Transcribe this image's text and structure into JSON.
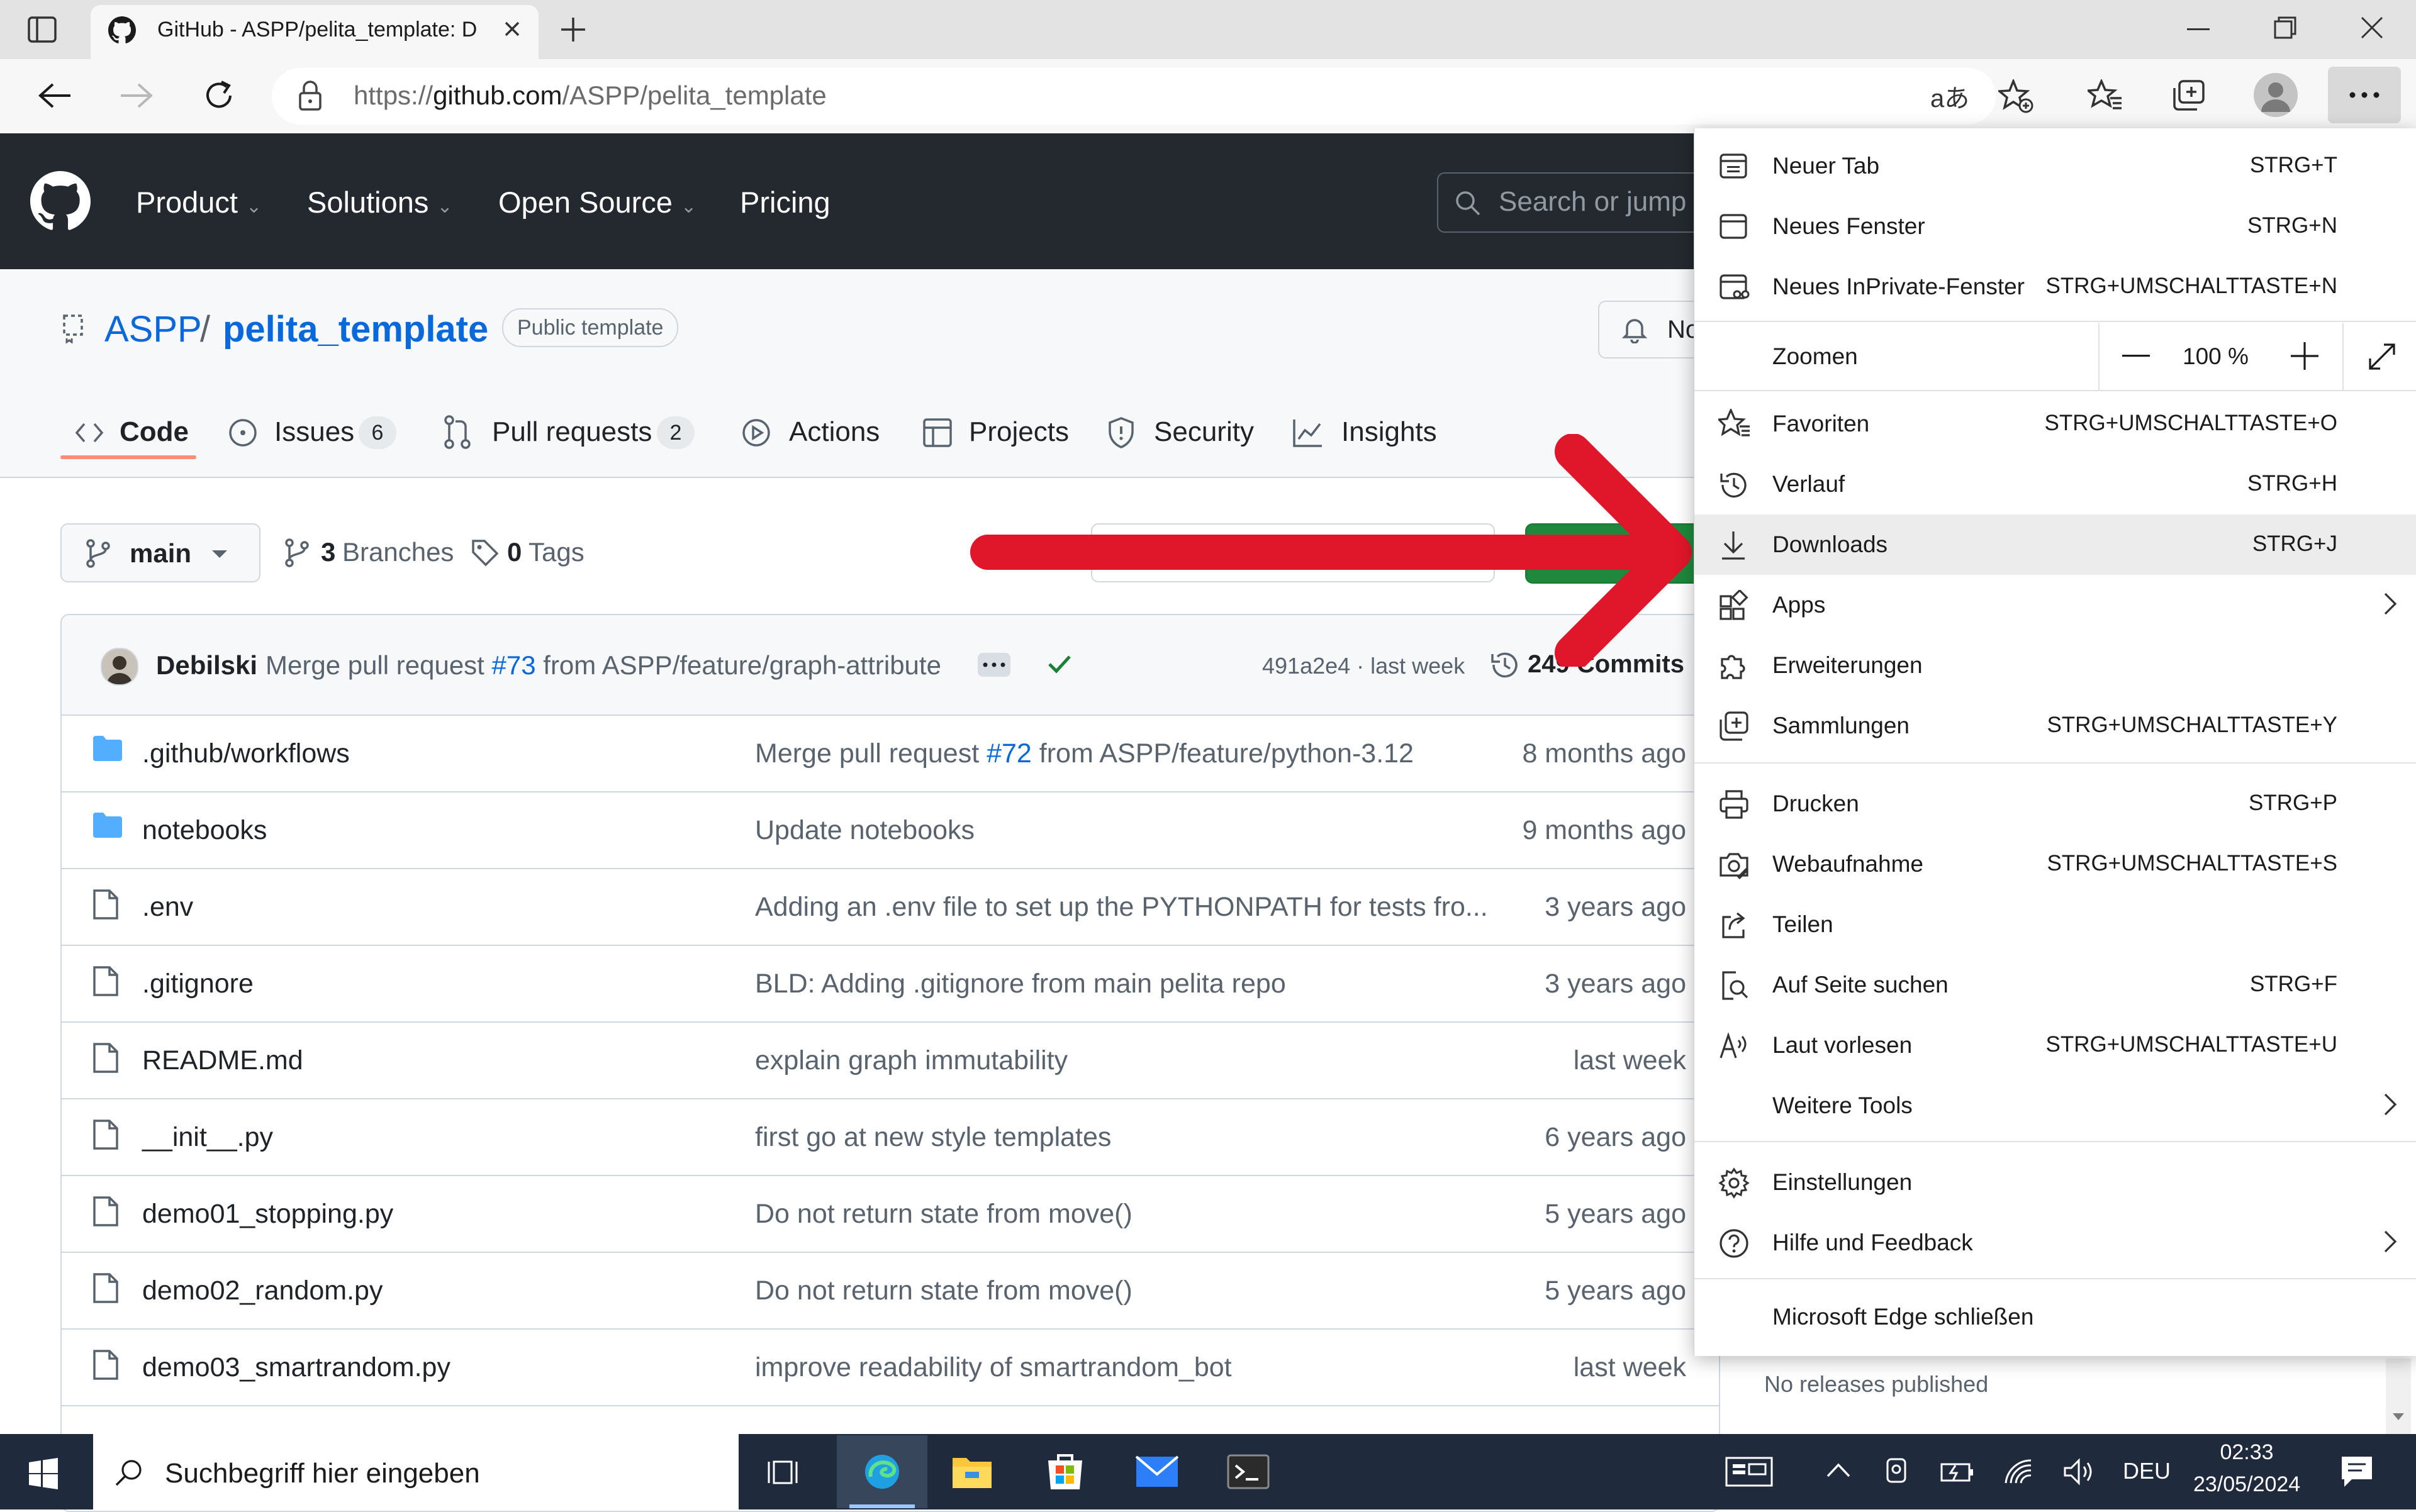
{
  "browser": {
    "tab_title": "GitHub - ASPP/pelita_template: D",
    "url_prefix": "https://",
    "url_domain": "github.com",
    "url_path": "/ASPP/pelita_template"
  },
  "github_header": {
    "nav": [
      "Product",
      "Solutions",
      "Open Source",
      "Pricing"
    ],
    "search_placeholder": "Search or jump t"
  },
  "repo": {
    "owner": "ASPP",
    "separator": "/",
    "name": "pelita_template",
    "badge": "Public template",
    "notify_label": "No",
    "tabs": [
      {
        "label": "Code",
        "count": ""
      },
      {
        "label": "Issues",
        "count": "6"
      },
      {
        "label": "Pull requests",
        "count": "2"
      },
      {
        "label": "Actions",
        "count": ""
      },
      {
        "label": "Projects",
        "count": ""
      },
      {
        "label": "Security",
        "count": ""
      },
      {
        "label": "Insights",
        "count": ""
      }
    ],
    "branch": "main",
    "branches_count": "3",
    "branches_label": "Branches",
    "tags_count": "0",
    "tags_label": "Tags"
  },
  "last_commit": {
    "author": "Debilski",
    "msg_prefix": "Merge pull request",
    "pr": "#73",
    "msg_suffix": "from ASPP/feature/graph-attribute",
    "sha_time": "491a2e4 · last week",
    "commits": "249 Commits"
  },
  "files": [
    {
      "name": ".github/workflows",
      "type": "folder",
      "msg_prefix": "Merge pull request ",
      "msg_link": "#72",
      "msg_suffix": " from ASPP/feature/python-3.12",
      "time": "8 months ago"
    },
    {
      "name": "notebooks",
      "type": "folder",
      "msg_prefix": "Update notebooks",
      "msg_link": "",
      "msg_suffix": "",
      "time": "9 months ago"
    },
    {
      "name": ".env",
      "type": "file",
      "msg_prefix": "Adding an .env file to set up the PYTHONPATH for tests fro...",
      "msg_link": "",
      "msg_suffix": "",
      "time": "3 years ago"
    },
    {
      "name": ".gitignore",
      "type": "file",
      "msg_prefix": "BLD: Adding .gitignore from main pelita repo",
      "msg_link": "",
      "msg_suffix": "",
      "time": "3 years ago"
    },
    {
      "name": "README.md",
      "type": "file",
      "msg_prefix": "explain graph immutability",
      "msg_link": "",
      "msg_suffix": "",
      "time": "last week"
    },
    {
      "name": "__init__.py",
      "type": "file",
      "msg_prefix": "first go at new style templates",
      "msg_link": "",
      "msg_suffix": "",
      "time": "6 years ago"
    },
    {
      "name": "demo01_stopping.py",
      "type": "file",
      "msg_prefix": "Do not return state from move()",
      "msg_link": "",
      "msg_suffix": "",
      "time": "5 years ago"
    },
    {
      "name": "demo02_random.py",
      "type": "file",
      "msg_prefix": "Do not return state from move()",
      "msg_link": "",
      "msg_suffix": "",
      "time": "5 years ago"
    },
    {
      "name": "demo03_smartrandom.py",
      "type": "file",
      "msg_prefix": "improve readability of smartrandom_bot",
      "msg_link": "",
      "msg_suffix": "",
      "time": "last week"
    }
  ],
  "sidebar": {
    "releases_text": "No releases published"
  },
  "edge_menu": {
    "new_tab": {
      "label": "Neuer Tab",
      "shortcut": "STRG+T"
    },
    "new_window": {
      "label": "Neues Fenster",
      "shortcut": "STRG+N"
    },
    "inprivate": {
      "label": "Neues InPrivate-Fenster",
      "shortcut": "STRG+UMSCHALTTASTE+N"
    },
    "zoom": {
      "label": "Zoomen",
      "value": "100 %"
    },
    "favorites": {
      "label": "Favoriten",
      "shortcut": "STRG+UMSCHALTTASTE+O"
    },
    "history": {
      "label": "Verlauf",
      "shortcut": "STRG+H"
    },
    "downloads": {
      "label": "Downloads",
      "shortcut": "STRG+J"
    },
    "apps": {
      "label": "Apps"
    },
    "extensions": {
      "label": "Erweiterungen"
    },
    "collections": {
      "label": "Sammlungen",
      "shortcut": "STRG+UMSCHALTTASTE+Y"
    },
    "print": {
      "label": "Drucken",
      "shortcut": "STRG+P"
    },
    "screenshot": {
      "label": "Webaufnahme",
      "shortcut": "STRG+UMSCHALTTASTE+S"
    },
    "share": {
      "label": "Teilen"
    },
    "find": {
      "label": "Auf Seite suchen",
      "shortcut": "STRG+F"
    },
    "read_aloud": {
      "label": "Laut vorlesen",
      "shortcut": "STRG+UMSCHALTTASTE+U"
    },
    "more_tools": {
      "label": "Weitere Tools"
    },
    "settings": {
      "label": "Einstellungen"
    },
    "help": {
      "label": "Hilfe und Feedback"
    },
    "close_edge": {
      "label": "Microsoft Edge schließen"
    }
  },
  "taskbar": {
    "search_placeholder": "Suchbegriff hier eingeben",
    "language": "DEU",
    "time": "02:33",
    "date": "23/05/2024"
  },
  "colors": {
    "github_header": "#24292f",
    "link": "#0969da",
    "green_check": "#1a7f37",
    "annotation_arrow": "#e0162b",
    "taskbar": "#1f2a3c"
  }
}
